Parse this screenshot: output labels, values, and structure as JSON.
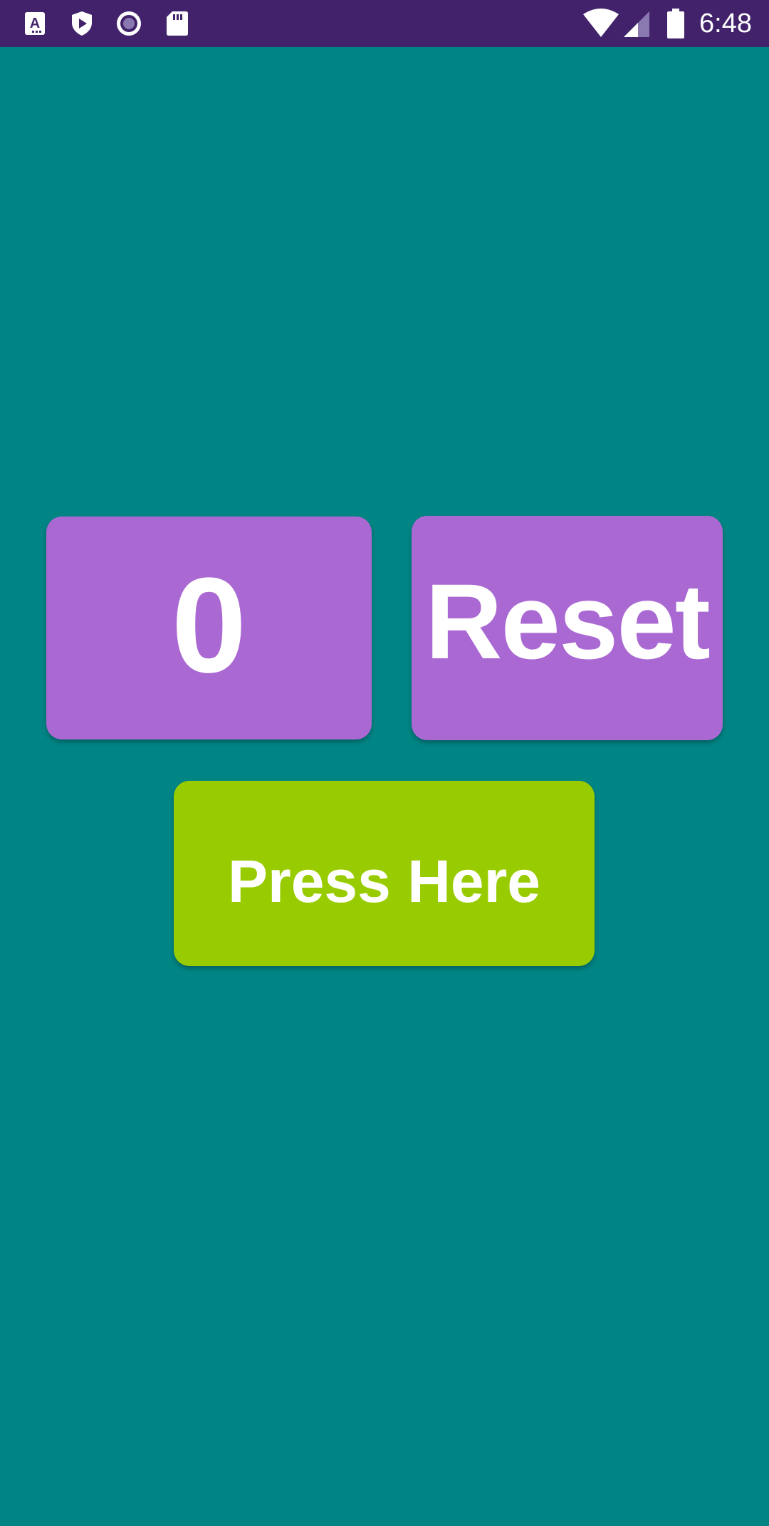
{
  "status_bar": {
    "time": "6:48",
    "background_color": "#42236b",
    "left_icons": [
      "a-letter-icon",
      "shield-play-icon",
      "record-icon",
      "sd-card-icon"
    ],
    "right_icons": [
      "wifi-icon",
      "cell-signal-icon",
      "battery-icon"
    ]
  },
  "main": {
    "background_color": "#008484",
    "counter_button": {
      "label": "0",
      "color": "#aa69d2"
    },
    "reset_button": {
      "label": "Reset",
      "color": "#aa69d2"
    },
    "press_button": {
      "label": "Press Here",
      "color": "#99cc00"
    }
  }
}
